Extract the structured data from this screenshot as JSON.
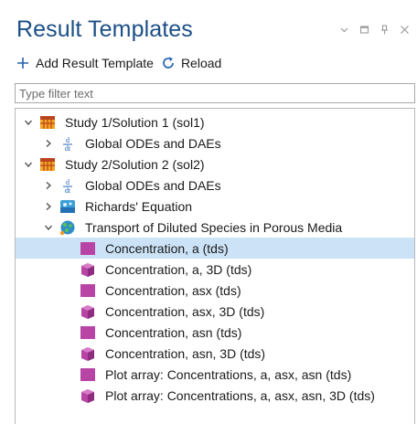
{
  "panel": {
    "title": "Result Templates",
    "controls": [
      "chevron-down-icon",
      "maximize-icon",
      "pin-icon",
      "close-icon"
    ]
  },
  "toolbar": {
    "add_label": "Add Result Template",
    "reload_label": "Reload"
  },
  "filter": {
    "placeholder": "Type filter text",
    "value": ""
  },
  "colors": {
    "title": "#1c4f86",
    "selection": "#cce3f7",
    "template_icon": "#b845a6",
    "solution_icon": "#b8451e"
  },
  "tree": [
    {
      "label": "Study 1/Solution 1 (sol1)",
      "level": 0,
      "toggle": "expanded",
      "icon": "solution-icon"
    },
    {
      "label": "Global ODEs and DAEs",
      "level": 1,
      "toggle": "collapsed",
      "icon": "ode-icon"
    },
    {
      "label": "Study 2/Solution 2 (sol2)",
      "level": 0,
      "toggle": "expanded",
      "icon": "solution-icon"
    },
    {
      "label": "Global ODEs and DAEs",
      "level": 1,
      "toggle": "collapsed",
      "icon": "ode-icon"
    },
    {
      "label": "Richards' Equation",
      "level": 1,
      "toggle": "collapsed",
      "icon": "richards-icon"
    },
    {
      "label": "Transport of Diluted Species in Porous Media",
      "level": 1,
      "toggle": "expanded",
      "icon": "transport-icon"
    },
    {
      "label": "Concentration, a (tds)",
      "level": 2,
      "toggle": "none",
      "icon": "template-2d-icon",
      "selected": true
    },
    {
      "label": "Concentration, a, 3D (tds)",
      "level": 2,
      "toggle": "none",
      "icon": "template-3d-icon"
    },
    {
      "label": "Concentration, asx (tds)",
      "level": 2,
      "toggle": "none",
      "icon": "template-2d-icon"
    },
    {
      "label": "Concentration, asx, 3D (tds)",
      "level": 2,
      "toggle": "none",
      "icon": "template-3d-icon"
    },
    {
      "label": "Concentration, asn (tds)",
      "level": 2,
      "toggle": "none",
      "icon": "template-2d-icon"
    },
    {
      "label": "Concentration, asn, 3D (tds)",
      "level": 2,
      "toggle": "none",
      "icon": "template-3d-icon"
    },
    {
      "label": "Plot array: Concentrations, a, asx, asn (tds)",
      "level": 2,
      "toggle": "none",
      "icon": "template-2d-icon"
    },
    {
      "label": "Plot array: Concentrations, a, asx, asn, 3D (tds)",
      "level": 2,
      "toggle": "none",
      "icon": "template-3d-icon"
    }
  ]
}
